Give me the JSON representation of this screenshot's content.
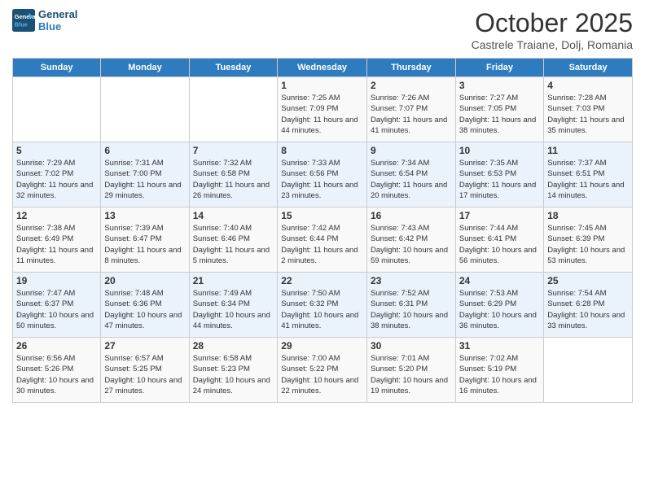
{
  "header": {
    "logo_line1": "General",
    "logo_line2": "Blue",
    "month_year": "October 2025",
    "location": "Castrele Traiane, Dolj, Romania"
  },
  "days_of_week": [
    "Sunday",
    "Monday",
    "Tuesday",
    "Wednesday",
    "Thursday",
    "Friday",
    "Saturday"
  ],
  "weeks": [
    [
      {
        "num": "",
        "info": ""
      },
      {
        "num": "",
        "info": ""
      },
      {
        "num": "",
        "info": ""
      },
      {
        "num": "1",
        "info": "Sunrise: 7:25 AM\nSunset: 7:09 PM\nDaylight: 11 hours and 44 minutes."
      },
      {
        "num": "2",
        "info": "Sunrise: 7:26 AM\nSunset: 7:07 PM\nDaylight: 11 hours and 41 minutes."
      },
      {
        "num": "3",
        "info": "Sunrise: 7:27 AM\nSunset: 7:05 PM\nDaylight: 11 hours and 38 minutes."
      },
      {
        "num": "4",
        "info": "Sunrise: 7:28 AM\nSunset: 7:03 PM\nDaylight: 11 hours and 35 minutes."
      }
    ],
    [
      {
        "num": "5",
        "info": "Sunrise: 7:29 AM\nSunset: 7:02 PM\nDaylight: 11 hours and 32 minutes."
      },
      {
        "num": "6",
        "info": "Sunrise: 7:31 AM\nSunset: 7:00 PM\nDaylight: 11 hours and 29 minutes."
      },
      {
        "num": "7",
        "info": "Sunrise: 7:32 AM\nSunset: 6:58 PM\nDaylight: 11 hours and 26 minutes."
      },
      {
        "num": "8",
        "info": "Sunrise: 7:33 AM\nSunset: 6:56 PM\nDaylight: 11 hours and 23 minutes."
      },
      {
        "num": "9",
        "info": "Sunrise: 7:34 AM\nSunset: 6:54 PM\nDaylight: 11 hours and 20 minutes."
      },
      {
        "num": "10",
        "info": "Sunrise: 7:35 AM\nSunset: 6:53 PM\nDaylight: 11 hours and 17 minutes."
      },
      {
        "num": "11",
        "info": "Sunrise: 7:37 AM\nSunset: 6:51 PM\nDaylight: 11 hours and 14 minutes."
      }
    ],
    [
      {
        "num": "12",
        "info": "Sunrise: 7:38 AM\nSunset: 6:49 PM\nDaylight: 11 hours and 11 minutes."
      },
      {
        "num": "13",
        "info": "Sunrise: 7:39 AM\nSunset: 6:47 PM\nDaylight: 11 hours and 8 minutes."
      },
      {
        "num": "14",
        "info": "Sunrise: 7:40 AM\nSunset: 6:46 PM\nDaylight: 11 hours and 5 minutes."
      },
      {
        "num": "15",
        "info": "Sunrise: 7:42 AM\nSunset: 6:44 PM\nDaylight: 11 hours and 2 minutes."
      },
      {
        "num": "16",
        "info": "Sunrise: 7:43 AM\nSunset: 6:42 PM\nDaylight: 10 hours and 59 minutes."
      },
      {
        "num": "17",
        "info": "Sunrise: 7:44 AM\nSunset: 6:41 PM\nDaylight: 10 hours and 56 minutes."
      },
      {
        "num": "18",
        "info": "Sunrise: 7:45 AM\nSunset: 6:39 PM\nDaylight: 10 hours and 53 minutes."
      }
    ],
    [
      {
        "num": "19",
        "info": "Sunrise: 7:47 AM\nSunset: 6:37 PM\nDaylight: 10 hours and 50 minutes."
      },
      {
        "num": "20",
        "info": "Sunrise: 7:48 AM\nSunset: 6:36 PM\nDaylight: 10 hours and 47 minutes."
      },
      {
        "num": "21",
        "info": "Sunrise: 7:49 AM\nSunset: 6:34 PM\nDaylight: 10 hours and 44 minutes."
      },
      {
        "num": "22",
        "info": "Sunrise: 7:50 AM\nSunset: 6:32 PM\nDaylight: 10 hours and 41 minutes."
      },
      {
        "num": "23",
        "info": "Sunrise: 7:52 AM\nSunset: 6:31 PM\nDaylight: 10 hours and 38 minutes."
      },
      {
        "num": "24",
        "info": "Sunrise: 7:53 AM\nSunset: 6:29 PM\nDaylight: 10 hours and 36 minutes."
      },
      {
        "num": "25",
        "info": "Sunrise: 7:54 AM\nSunset: 6:28 PM\nDaylight: 10 hours and 33 minutes."
      }
    ],
    [
      {
        "num": "26",
        "info": "Sunrise: 6:56 AM\nSunset: 5:26 PM\nDaylight: 10 hours and 30 minutes."
      },
      {
        "num": "27",
        "info": "Sunrise: 6:57 AM\nSunset: 5:25 PM\nDaylight: 10 hours and 27 minutes."
      },
      {
        "num": "28",
        "info": "Sunrise: 6:58 AM\nSunset: 5:23 PM\nDaylight: 10 hours and 24 minutes."
      },
      {
        "num": "29",
        "info": "Sunrise: 7:00 AM\nSunset: 5:22 PM\nDaylight: 10 hours and 22 minutes."
      },
      {
        "num": "30",
        "info": "Sunrise: 7:01 AM\nSunset: 5:20 PM\nDaylight: 10 hours and 19 minutes."
      },
      {
        "num": "31",
        "info": "Sunrise: 7:02 AM\nSunset: 5:19 PM\nDaylight: 10 hours and 16 minutes."
      },
      {
        "num": "",
        "info": ""
      }
    ]
  ]
}
